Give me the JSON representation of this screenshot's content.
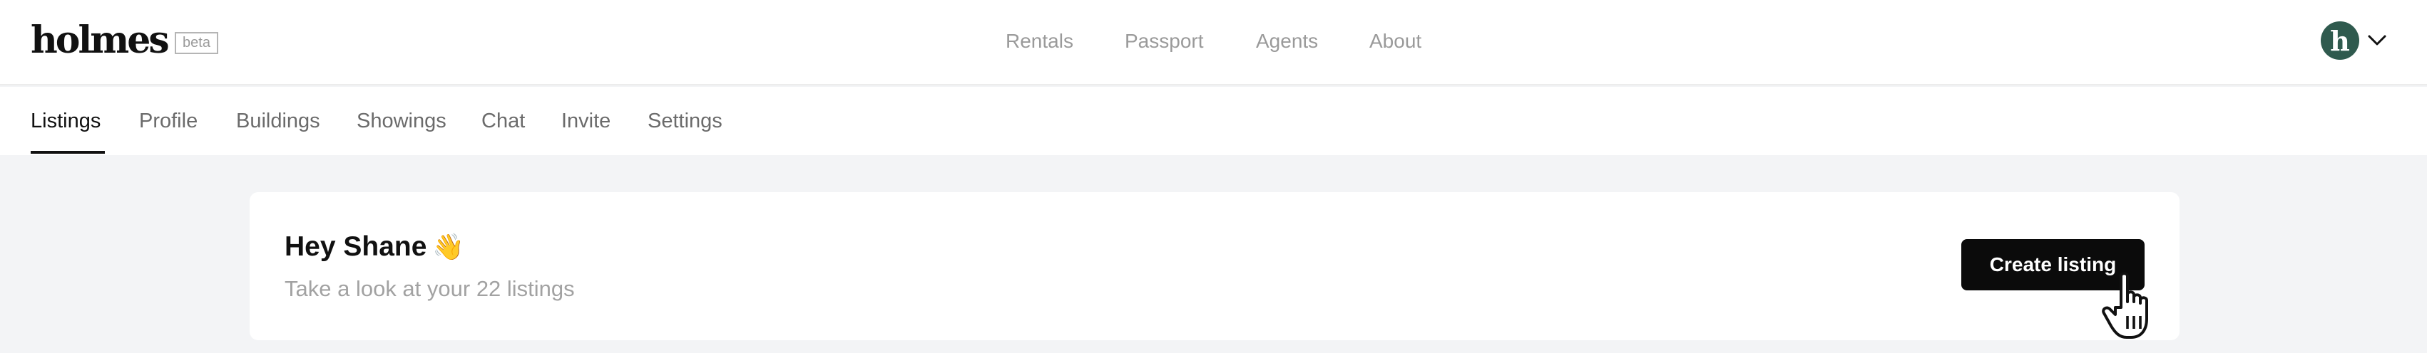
{
  "header": {
    "logo": "holmes",
    "badge": "beta",
    "nav": [
      "Rentals",
      "Passport",
      "Agents",
      "About"
    ],
    "avatar_letter": "h",
    "avatar_color": "#2f5a4e",
    "icons": [
      "chevron-down-icon",
      "hand-pointer-cursor-icon"
    ]
  },
  "tabs": [
    "Listings",
    "Profile",
    "Buildings",
    "Showings",
    "Chat",
    "Invite",
    "Settings"
  ],
  "active_tab": "Listings",
  "card": {
    "greeting": "Hey Shane",
    "greeting_emoji": "👋",
    "subtext": "Take a look at your 22 listings",
    "button_label": "Create listing"
  }
}
